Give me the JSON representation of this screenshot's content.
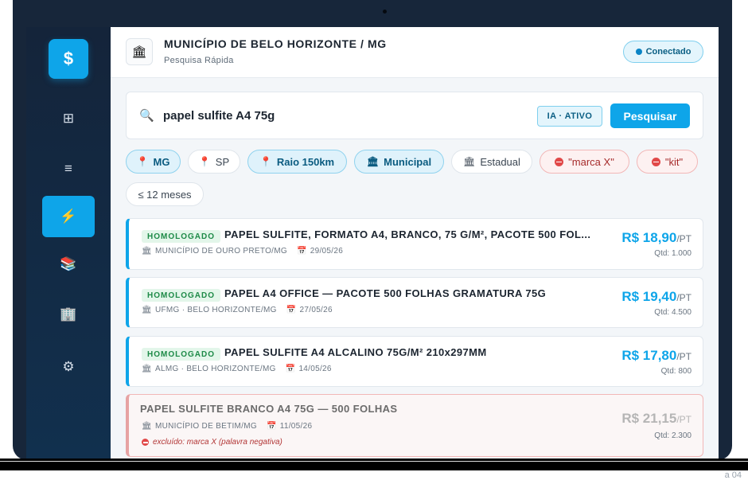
{
  "header": {
    "title": "MUNICÍPIO DE BELO HORIZONTE / MG",
    "subtitle": "Pesquisa Rápida",
    "status": "Conectado"
  },
  "sidebar": {
    "logo": "$",
    "items": [
      {
        "name": "grid-icon",
        "glyph": "⊞"
      },
      {
        "name": "list-icon",
        "glyph": "≡"
      },
      {
        "name": "lightning-icon",
        "glyph": "⚡"
      },
      {
        "name": "books-icon",
        "glyph": "📚"
      },
      {
        "name": "building-icon",
        "glyph": "🏢"
      },
      {
        "name": "gear-icon",
        "glyph": "⚙"
      }
    ]
  },
  "search": {
    "query": "papel sulfite A4 75g",
    "ai_badge": "IA · ATIVO",
    "button": "Pesquisar"
  },
  "filters": [
    {
      "label": "MG",
      "icon": "📍",
      "on": true
    },
    {
      "label": "SP",
      "icon": "📍",
      "on": false
    },
    {
      "label": "Raio 150km",
      "icon": "📍",
      "on": true
    },
    {
      "label": "Municipal",
      "icon": "🏛",
      "on": true
    },
    {
      "label": "Estadual",
      "icon": "🏛",
      "on": false
    },
    {
      "label": "\"marca X\"",
      "negative": true
    },
    {
      "label": "\"kit\"",
      "negative": true
    },
    {
      "label": "≤ 12 meses",
      "on": false
    }
  ],
  "results": [
    {
      "badge": "HOMOLOGADO",
      "title": "PAPEL SULFITE, FORMATO A4, BRANCO, 75 G/M², PACOTE 500 FOL...",
      "entity": "MUNICÍPIO DE OURO PRETO/MG",
      "date": "29/05/26",
      "price": "R$ 18,90",
      "unit": "/PT",
      "qty": "Qtd: 1.000"
    },
    {
      "badge": "HOMOLOGADO",
      "title": "PAPEL A4 OFFICE — PACOTE 500 FOLHAS GRAMATURA 75G",
      "entity": "UFMG · BELO HORIZONTE/MG",
      "date": "27/05/26",
      "price": "R$ 19,40",
      "unit": "/PT",
      "qty": "Qtd: 4.500"
    },
    {
      "badge": "HOMOLOGADO",
      "title": "PAPEL SULFITE A4 ALCALINO 75G/M² 210x297MM",
      "entity": "ALMG · BELO HORIZONTE/MG",
      "date": "14/05/26",
      "price": "R$ 17,80",
      "unit": "/PT",
      "qty": "Qtd: 800"
    },
    {
      "title": "PAPEL SULFITE BRANCO A4 75G — 500 FOLHAS",
      "entity": "MUNICÍPIO DE BETIM/MG",
      "date": "11/05/26",
      "price": "R$ 21,15",
      "unit": "/PT",
      "qty": "Qtd: 2.300",
      "excluded_note": "excluído: marca X (palavra negativa)"
    }
  ],
  "colors": {
    "accent": "#0ea5e9",
    "sidebar": "#14243a",
    "success": "#1d8a47",
    "danger": "#e14848"
  },
  "footer_fragment": "a 04"
}
